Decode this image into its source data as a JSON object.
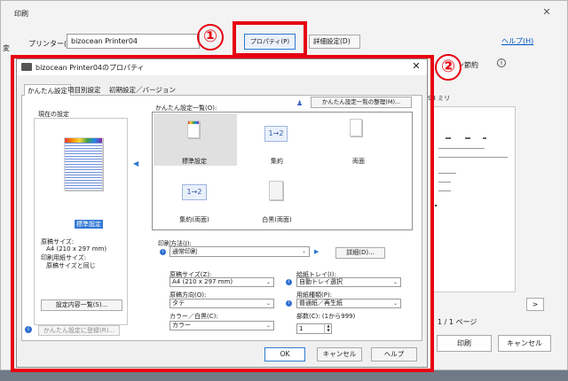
{
  "print_dialog": {
    "title": "印刷",
    "close_glyph": "✕",
    "left_cut_text": "変",
    "printer_label": "プリンター(N):",
    "printer_name": "bizocean Printer04",
    "properties_button": "プロパティ(P)",
    "advanced_button": "詳細設定(D)",
    "help_link": "ヘルプ(H)",
    "eco_text": "ン節約",
    "info_glyph": "i",
    "paper_size_text": "93 ミリ",
    "next_page_glyph": ">",
    "page_count": "1 / 1 ページ",
    "print_button": "印刷",
    "cancel_button": "キャンセル"
  },
  "callouts": {
    "one": "①",
    "two": "②"
  },
  "properties": {
    "title": "bizocean Printer04のプロパティ",
    "close_glyph": "✕",
    "tabs": [
      "かんたん設定",
      "項目別設定",
      "初期設定／バージョン"
    ],
    "current_settings_label": "現在の設定",
    "current_setting_name": "標準設定",
    "original_size_label": "原稿サイズ:",
    "original_size_value": "A4 (210 x 297 mm)",
    "print_paper_size_label": "印刷用紙サイズ:",
    "print_paper_size_value": "原稿サイズと同じ",
    "settings_list_button": "設定内容一覧(S)...",
    "register_button": "かんたん設定に登録(R)...",
    "easy_list_label": "かんたん設定一覧(O):",
    "organize_button": "かんたん設定一覧の整理(M)...",
    "presets": [
      {
        "label": "標準設定",
        "icon": "page-color-icon"
      },
      {
        "label": "集約",
        "icon": "n-up-icon",
        "icon_text": "1→2"
      },
      {
        "label": "両面",
        "icon": "duplex-icon"
      },
      {
        "label": "集約(両面)",
        "icon": "n-up-duplex-icon",
        "icon_text": "1→2"
      },
      {
        "label": "白黒(両面)",
        "icon": "mono-duplex-icon"
      }
    ],
    "print_method_label": "印刷方法(J):",
    "print_method_value": "通常印刷",
    "details_button": "詳細(D)...",
    "original_size_field_label": "原稿サイズ(Z):",
    "original_size_field_value": "A4 (210 x 297 mm)",
    "orientation_label": "原稿方向(O):",
    "orientation_value": "タテ",
    "color_label": "カラー／白黒(C):",
    "color_value": "カラー",
    "paper_tray_label": "給紙トレイ(I):",
    "paper_tray_value": "自動トレイ選択",
    "paper_type_label": "用紙種類(P):",
    "paper_type_value": "普通紙／再生紙",
    "copies_label": "部数(C): (1から999)",
    "copies_value": "1",
    "ok_button": "OK",
    "cancel_button": "キャンセル",
    "help_button": "ヘルプ"
  },
  "colors": {
    "accent": "#2f7ad1",
    "callout_red": "#e60012",
    "selection": "#3478d6"
  }
}
